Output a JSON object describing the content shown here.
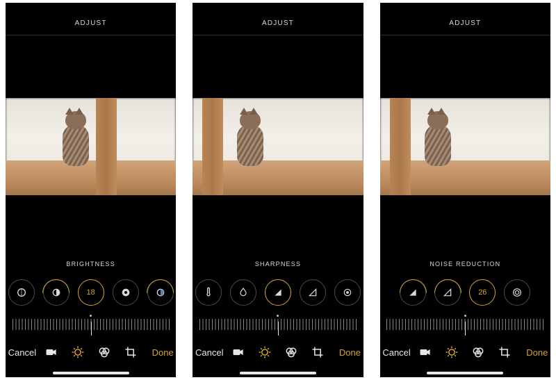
{
  "colors": {
    "accent": "#d5a327",
    "text": "#d9d9d9",
    "bg": "#000000"
  },
  "screens": [
    {
      "header": "ADJUST",
      "param_label": "BRIGHTNESS",
      "active_value": "18",
      "dials": [
        {
          "name": "exposure-icon",
          "type": "icon",
          "active": false,
          "arc": false
        },
        {
          "name": "highlights-icon",
          "type": "icon",
          "active": false,
          "arc": true
        },
        {
          "name": "brightness-value",
          "type": "value",
          "active": true,
          "arc": false
        },
        {
          "name": "black-point-icon",
          "type": "icon",
          "active": false,
          "arc": false
        },
        {
          "name": "saturation-icon",
          "type": "icon",
          "active": false,
          "arc": true
        }
      ],
      "cancel": "Cancel",
      "done": "Done"
    },
    {
      "header": "ADJUST",
      "param_label": "SHARPNESS",
      "active_value": "",
      "dials": [
        {
          "name": "warmth-icon",
          "type": "icon",
          "active": false,
          "arc": false
        },
        {
          "name": "tint-icon",
          "type": "icon",
          "active": false,
          "arc": false
        },
        {
          "name": "sharpness-icon",
          "type": "icon",
          "active": true,
          "arc": false
        },
        {
          "name": "definition-icon",
          "type": "icon",
          "active": false,
          "arc": false
        },
        {
          "name": "noise-reduction-icon",
          "type": "icon",
          "active": false,
          "arc": false
        }
      ],
      "cancel": "Cancel",
      "done": "Done"
    },
    {
      "header": "ADJUST",
      "param_label": "NOISE REDUCTION",
      "active_value": "26",
      "dials": [
        {
          "name": "sharpness-icon",
          "type": "icon",
          "active": false,
          "arc": true
        },
        {
          "name": "definition-icon",
          "type": "icon",
          "active": false,
          "arc": true
        },
        {
          "name": "noise-reduction-value",
          "type": "value",
          "active": true,
          "arc": false
        },
        {
          "name": "vignette-icon",
          "type": "icon",
          "active": false,
          "arc": false
        }
      ],
      "cancel": "Cancel",
      "done": "Done"
    }
  ],
  "toolbar_icons": [
    {
      "name": "video-icon",
      "selected": false
    },
    {
      "name": "adjust-icon",
      "selected": true
    },
    {
      "name": "filters-icon",
      "selected": false
    },
    {
      "name": "crop-icon",
      "selected": false
    }
  ]
}
